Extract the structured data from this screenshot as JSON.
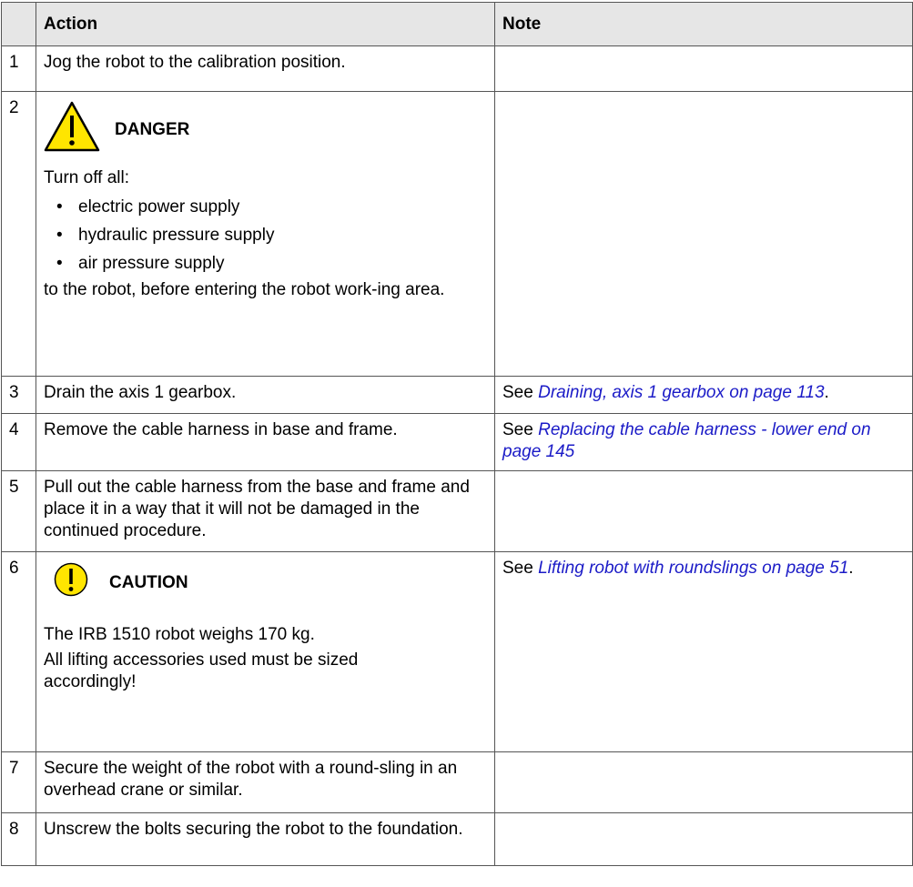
{
  "header": {
    "num": "",
    "action": "Action",
    "note": "Note"
  },
  "rows": [
    {
      "num": "1",
      "action": "Jog the robot to the calibration position."
    },
    {
      "num": "2",
      "sign": {
        "label": "DANGER",
        "icon": "warning-triangle-icon"
      },
      "intro": "Turn off all:",
      "items": [
        "electric power supply",
        "hydraulic pressure supply",
        "air pressure supply"
      ],
      "outro": "to the robot, before entering the robot work-ing area."
    },
    {
      "num": "3",
      "action": "Drain the axis 1 gearbox.",
      "note": {
        "prefix": "See ",
        "link": "Draining, axis 1 gearbox on page 113",
        "suffix": "."
      }
    },
    {
      "num": "4",
      "action": "Remove the cable harness in base and frame.",
      "note": {
        "prefix": "See ",
        "link": "Replacing the cable harness - lower end on page 145",
        "suffix": ""
      }
    },
    {
      "num": "5",
      "action": "Pull out the cable harness from the base and frame and place it in a way that it will not be damaged in the continued procedure."
    },
    {
      "num": "6",
      "sign": {
        "label": "CAUTION",
        "icon": "caution-circle-icon"
      },
      "line1": "The IRB 1510 robot weighs 170 kg.",
      "line2": "All lifting accessories used must be sized accordingly!",
      "note": {
        "prefix": "See ",
        "link": "Lifting robot with roundslings on page 51",
        "suffix": "."
      }
    },
    {
      "num": "7",
      "action": "Secure the weight of the robot with a round-sling in an overhead crane or similar."
    },
    {
      "num": "8",
      "action": "Unscrew the bolts securing the robot to the foundation."
    }
  ],
  "colors": {
    "header_bg": "#e6e6e6",
    "link": "#1b1bc7",
    "danger_yellow": "#ffe500",
    "border": "#555555"
  }
}
